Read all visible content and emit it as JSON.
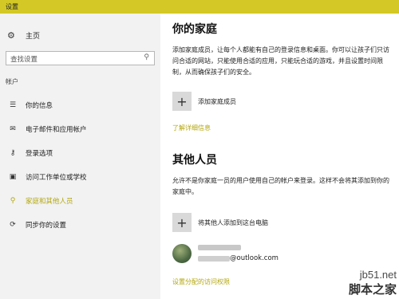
{
  "window": {
    "title": "设置"
  },
  "sidebar": {
    "home": {
      "icon": "gear-icon",
      "label": "主页"
    },
    "search": {
      "placeholder": "查找设置",
      "icon": "search-icon"
    },
    "section_label": "帐户",
    "items": [
      {
        "icon": "person-card-icon",
        "label": "你的信息",
        "active": false
      },
      {
        "icon": "mail-icon",
        "label": "电子邮件和应用帐户",
        "active": false
      },
      {
        "icon": "key-icon",
        "label": "登录选项",
        "active": false
      },
      {
        "icon": "briefcase-icon",
        "label": "访问工作单位或学校",
        "active": false
      },
      {
        "icon": "people-icon",
        "label": "家庭和其他人员",
        "active": true
      },
      {
        "icon": "sync-icon",
        "label": "同步你的设置",
        "active": false
      }
    ]
  },
  "main": {
    "family": {
      "heading": "你的家庭",
      "description": "添加家庭成员，让每个人都能有自己的登录信息和桌面。你可以让孩子们只访问合适的网站，只能使用合适的应用，只能玩合适的游戏，并且设置时间限制，从而确保孩子们的安全。",
      "add_label": "添加家庭成员",
      "learn_more": "了解详细信息"
    },
    "others": {
      "heading": "其他人员",
      "description": "允许不是你家庭一员的用户使用自己的帐户来登录。这样不会将其添加到你的家庭中。",
      "add_label": "将其他人添加到这台电脑",
      "member_email_domain": "@outlook.com",
      "access_link": "设置分配的访问权限"
    }
  },
  "watermark": {
    "line1": "jb51.net",
    "line2": "脚本之家"
  },
  "colors": {
    "titlebar": "#d3c826",
    "accent": "#b3a70e",
    "sidebar_bg": "#f2f2f2"
  }
}
